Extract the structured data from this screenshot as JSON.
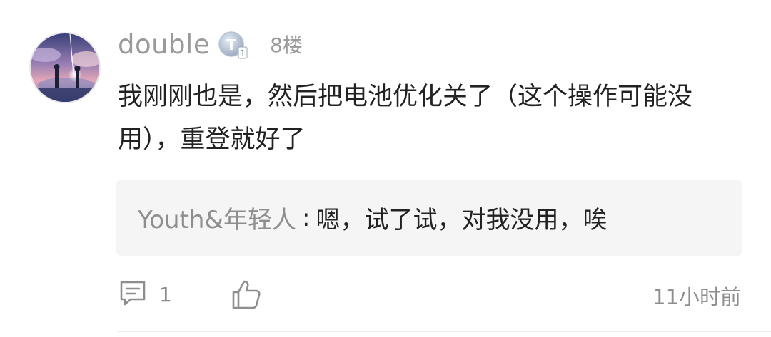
{
  "comment": {
    "username": "double",
    "level_badge_text": "T",
    "level_badge_number": "1",
    "floor": "8楼",
    "text": "我刚刚也是，然后把电池优化关了（这个操作可能没用），重登就好了"
  },
  "reply": {
    "author": "Youth&年轻人",
    "separator": ":",
    "text": "嗯，试了试，对我没用，唉"
  },
  "footer": {
    "comment_count": "1",
    "time": "11小时前"
  },
  "icons": {
    "comment": "comment-icon",
    "like": "thumbs-up-icon",
    "badge": "level-badge-icon"
  },
  "colors": {
    "muted_text": "#9a9a9a",
    "body_text": "#222222",
    "reply_bg": "#f5f5f5"
  }
}
